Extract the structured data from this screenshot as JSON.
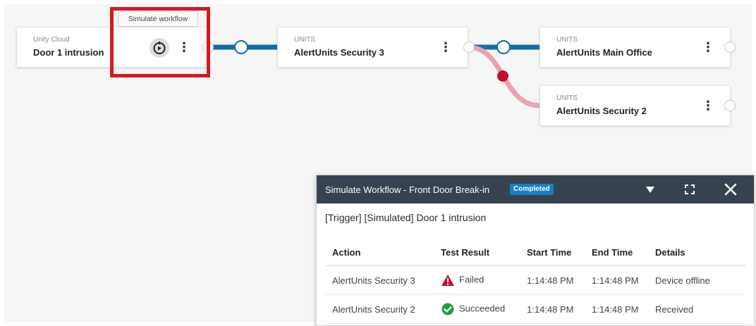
{
  "nodes": {
    "trigger": {
      "subtitle": "Unity Cloud",
      "title": "Door 1 intrusion"
    },
    "security3": {
      "subtitle": "UNITS",
      "title": "AlertUnits Security 3"
    },
    "main_office": {
      "subtitle": "UNITS",
      "title": "AlertUnits Main Office"
    },
    "security2": {
      "subtitle": "UNITS",
      "title": "AlertUnits Security 2"
    }
  },
  "tooltip": "Simulate workflow",
  "menu_glyph": "⋮",
  "colors": {
    "highlight": "#d71920",
    "connector_active": "#0f6fa6",
    "connector_failed": "#e8a3ae",
    "failed_dot": "#c40d2e",
    "panel_header": "#36424f",
    "badge": "#1680c4"
  },
  "panel": {
    "title": "Simulate Workflow  -  Front Door Break-in",
    "status_badge": "Completed",
    "trigger_line": "[Trigger] [Simulated] Door 1 intrusion",
    "columns": [
      "Action",
      "Test Result",
      "Start Time",
      "End Time",
      "Details"
    ],
    "rows": [
      {
        "action": "AlertUnits Security 3",
        "result": "Failed",
        "result_icon": "warning-icon",
        "start": "1:14:48 PM",
        "end": "1:14:48 PM",
        "details": "Device offline"
      },
      {
        "action": "AlertUnits Security 2",
        "result": "Succeeded",
        "result_icon": "check-circle-icon",
        "start": "1:14:48 PM",
        "end": "1:14:48 PM",
        "details": "Received"
      }
    ]
  }
}
